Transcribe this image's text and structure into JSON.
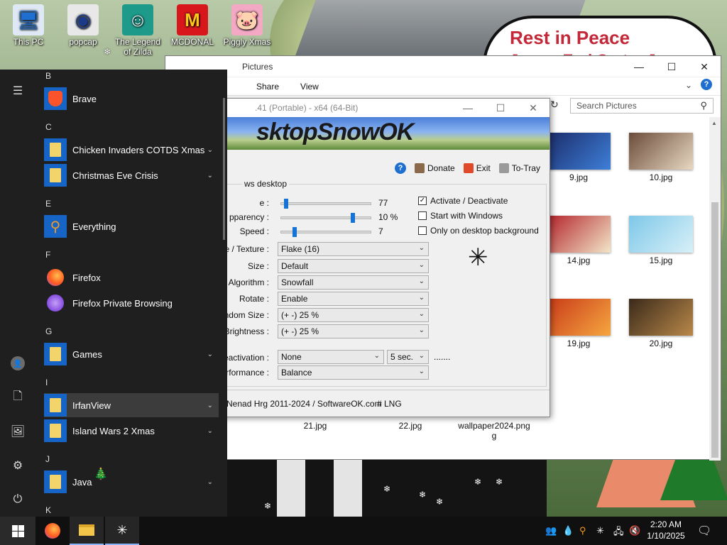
{
  "desktop": {
    "icons": [
      {
        "label": "This PC",
        "icon": "this-pc-icon"
      },
      {
        "label": "popcap",
        "icon": "popcap-icon"
      },
      {
        "label": "The Legend of Zilda",
        "icon": "legend-zilda-icon"
      },
      {
        "label": "MCDONAL",
        "icon": "mcdonalds-icon"
      },
      {
        "label": "Piggly Xmas",
        "icon": "piggly-icon"
      }
    ],
    "sign_title": "Rest in Peace",
    "sign_subtitle": "James Earl Carter Jr"
  },
  "explorer": {
    "title": "Pictures",
    "ribbon": [
      "Share",
      "View"
    ],
    "help": "?",
    "search_placeholder": "Search Pictures",
    "items": [
      {
        "name": "9.jpg",
        "color1": "#1b2c6a",
        "color2": "#3e7fd8"
      },
      {
        "name": "10.jpg",
        "color1": "#6b4c3a",
        "color2": "#e8d8c2"
      },
      {
        "name": "14.jpg",
        "color1": "#b3222a",
        "color2": "#f2e6c8"
      },
      {
        "name": "15.jpg",
        "color1": "#7ec8e8",
        "color2": "#d8f0f8"
      },
      {
        "name": "19.jpg",
        "color1": "#c93a18",
        "color2": "#f5a640"
      },
      {
        "name": "20.jpg",
        "color1": "#3a2a1a",
        "color2": "#b9884a"
      },
      {
        "name": "21.jpg"
      },
      {
        "name": "22.jpg"
      },
      {
        "name": "wallpaper2024.png",
        "name_line2": "g"
      }
    ]
  },
  "snowok": {
    "title": ".41 (Portable) - x64 (64-Bit)",
    "banner": "sktopSnowOK",
    "toolbar": {
      "help": "?",
      "donate": "Donate",
      "exit": "Exit",
      "totray": "To-Tray"
    },
    "group_label": "ws desktop",
    "sliders": [
      {
        "label": "e :",
        "value": "77",
        "pos": 0.05
      },
      {
        "label": "pparency :",
        "value": "10 %",
        "pos": 0.8
      },
      {
        "label": "Speed :",
        "value": "7",
        "pos": 0.12
      }
    ],
    "checks": [
      {
        "label": "Activate / Deactivate",
        "checked": "✓"
      },
      {
        "label": "Start with Windows",
        "checked": ""
      },
      {
        "label": "Only on desktop background",
        "checked": ""
      }
    ],
    "combos": [
      {
        "label": "ge / Texture :",
        "value": "Flake (16)"
      },
      {
        "label": "Size :",
        "value": "Default"
      },
      {
        "label": "Algorithm :",
        "value": "Snowfall"
      },
      {
        "label": "Rotate :",
        "value": "Enable"
      },
      {
        "label": "Random Size :",
        "value": "(+ -) 25 %"
      },
      {
        "label": "m Brightness :",
        "value": "(+ -) 25 %"
      }
    ],
    "deactivation_label": "Deactivation :",
    "deactivation_value": "None",
    "deactivation_secs": "5 sec.",
    "deactivation_dots": ".......",
    "performance_label": "Performance :",
    "performance_value": "Balance",
    "footer": "Nenad Hrg 2011-2024 / SoftwareOK.com",
    "lng": "# LNG"
  },
  "start_menu": {
    "groups": [
      {
        "letter": "B",
        "apps": [
          {
            "name": "Brave",
            "icon": "brave-icon",
            "folder": false
          }
        ]
      },
      {
        "letter": "C",
        "apps": [
          {
            "name": "Chicken Invaders COTDS Xmas",
            "folder": true
          },
          {
            "name": "Christmas Eve Crisis",
            "folder": true
          }
        ]
      },
      {
        "letter": "E",
        "apps": [
          {
            "name": "Everything",
            "icon": "everything-icon",
            "folder": false
          }
        ]
      },
      {
        "letter": "F",
        "apps": [
          {
            "name": "Firefox",
            "icon": "firefox-icon",
            "folder": false
          },
          {
            "name": "Firefox Private Browsing",
            "icon": "firefox-private-icon",
            "folder": false
          }
        ]
      },
      {
        "letter": "G",
        "apps": [
          {
            "name": "Games",
            "folder": true
          }
        ]
      },
      {
        "letter": "I",
        "apps": [
          {
            "name": "IrfanView",
            "folder": true
          },
          {
            "name": "Island Wars 2 Xmas",
            "folder": true
          }
        ]
      },
      {
        "letter": "J",
        "apps": [
          {
            "name": "Java",
            "folder": true
          }
        ]
      },
      {
        "letter": "K",
        "apps": []
      }
    ]
  },
  "taskbar": {
    "time": "2:20 AM",
    "date": "1/10/2025"
  },
  "colors": {
    "start_bg": "#1f1f1f",
    "taskbar_bg": "#101010",
    "accent": "#1673d6"
  }
}
